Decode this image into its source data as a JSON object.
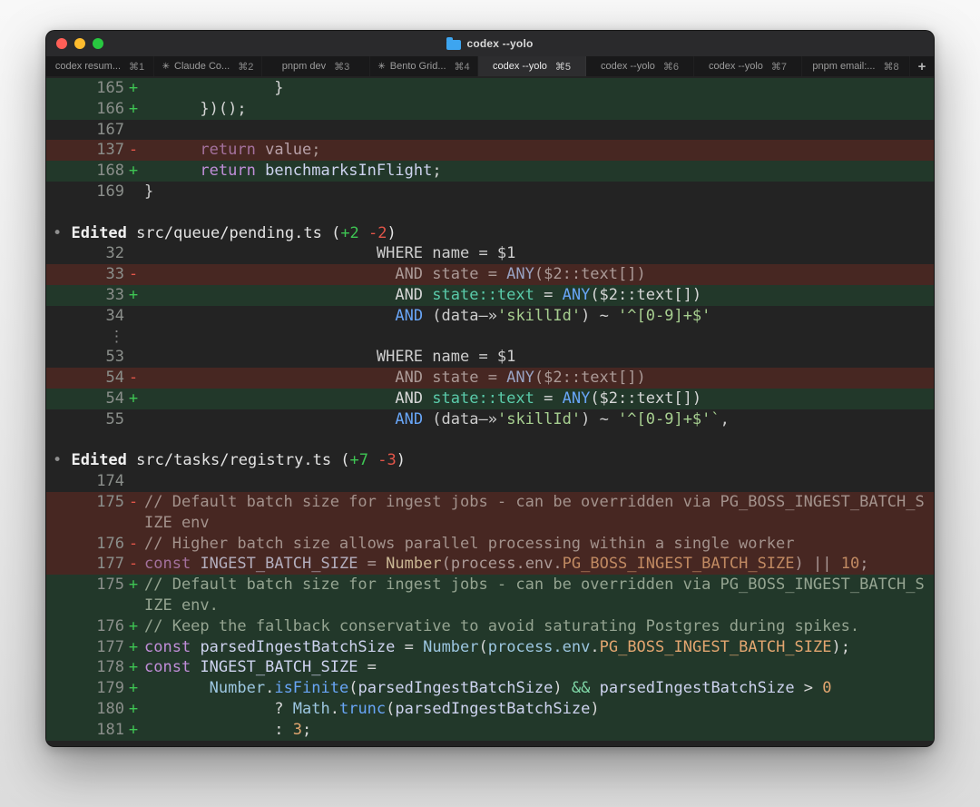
{
  "window": {
    "title": "codex --yolo"
  },
  "tabs": [
    {
      "label": "codex resum...",
      "shortcut": "⌘1",
      "active": false,
      "busy": false
    },
    {
      "label": "Claude Co...",
      "shortcut": "⌘2",
      "active": false,
      "busy": true
    },
    {
      "label": "pnpm dev",
      "shortcut": "⌘3",
      "active": false,
      "busy": false
    },
    {
      "label": "Bento Grid...",
      "shortcut": "⌘4",
      "active": false,
      "busy": true
    },
    {
      "label": "codex --yolo",
      "shortcut": "⌘5",
      "active": true,
      "busy": false
    },
    {
      "label": "codex --yolo",
      "shortcut": "⌘6",
      "active": false,
      "busy": false
    },
    {
      "label": "codex --yolo",
      "shortcut": "⌘7",
      "active": false,
      "busy": false
    },
    {
      "label": "pnpm email:...",
      "shortcut": "⌘8",
      "active": false,
      "busy": false
    }
  ],
  "new_tab_label": "+",
  "busy_icon": "✳",
  "colors": {
    "terminal_bg": "#232323",
    "add_bg": "#22382a",
    "del_bg": "#472722",
    "traffic_red": "#ff5f57",
    "traffic_yellow": "#febc2e",
    "traffic_green": "#28c840",
    "folder_icon": "#3da5f0",
    "palette": {
      "fg": "#d6d6d6",
      "ctx": "#cdcdcd",
      "kw": "#c08dd8",
      "kwdim": "#a3719d",
      "vr": "#ced3ef",
      "vrdim": "#b7a0a8",
      "vrdel": "#b3aebd",
      "blue": "#68a5f6",
      "bluedim": "#98a2c2",
      "teal": "#5acbaa",
      "op": "#80d8a8",
      "proc": "#9cc6e0",
      "str": "#a7cf90",
      "orange": "#e3a670",
      "orangedim": "#c18a62",
      "cream": "#c9b693",
      "com": "#95a491",
      "comdel": "#a3928c",
      "deltext": "#ab9a97",
      "bullet": "#8f8f8f",
      "hdrb": "#f0f0f0",
      "hdr": "#e3e3e3",
      "plus": "#3ec553",
      "minus": "#e25549",
      "dim": "#8a8a8a"
    }
  },
  "edits": [
    {
      "file": "src/queue/pending.ts",
      "added": 2,
      "removed": 2
    },
    {
      "file": "src/tasks/registry.ts",
      "added": 7,
      "removed": 3
    }
  ],
  "terminal": {
    "rows": [
      {
        "kind": "add",
        "num": "165",
        "sign": "+",
        "segs": [
          [
            "              }",
            "fg"
          ]
        ]
      },
      {
        "kind": "add",
        "num": "166",
        "sign": "+",
        "segs": [
          [
            "      })();",
            "fg"
          ]
        ]
      },
      {
        "kind": "ctx",
        "num": "167",
        "sign": "",
        "segs": []
      },
      {
        "kind": "del",
        "num": "137",
        "sign": "-",
        "segs": [
          [
            "      ",
            "deltext"
          ],
          [
            "return",
            "kwdim"
          ],
          [
            " ",
            "deltext"
          ],
          [
            "value",
            "vrdim"
          ],
          [
            ";",
            "deltext"
          ]
        ]
      },
      {
        "kind": "add",
        "num": "168",
        "sign": "+",
        "segs": [
          [
            "      ",
            "fg"
          ],
          [
            "return",
            "kw"
          ],
          [
            " ",
            "fg"
          ],
          [
            "benchmarksInFlight",
            "vr"
          ],
          [
            ";",
            "fg"
          ]
        ]
      },
      {
        "kind": "ctx",
        "num": "169",
        "sign": "",
        "segs": [
          [
            "}",
            "ctx"
          ]
        ]
      },
      {
        "kind": "blank"
      },
      {
        "kind": "header",
        "segs": [
          [
            "• ",
            "bullet"
          ],
          [
            "Edited",
            "hdrb"
          ],
          [
            " src/queue/pending.ts (",
            "hdr"
          ],
          [
            "+2",
            "plus"
          ],
          [
            " ",
            "hdr"
          ],
          [
            "-2",
            "minus"
          ],
          [
            ")",
            "hdr"
          ]
        ]
      },
      {
        "kind": "ctx",
        "num": "32",
        "sign": "",
        "segs": [
          [
            "                         WHERE name = $1",
            "ctx"
          ]
        ]
      },
      {
        "kind": "del",
        "num": "33",
        "sign": "-",
        "segs": [
          [
            "                           AND state = ",
            "deltext"
          ],
          [
            "ANY",
            "bluedim"
          ],
          [
            "($2::text[])",
            "deltext"
          ]
        ]
      },
      {
        "kind": "add",
        "num": "33",
        "sign": "+",
        "segs": [
          [
            "                           AND ",
            "fg"
          ],
          [
            "state::text",
            "teal"
          ],
          [
            " = ",
            "fg"
          ],
          [
            "ANY",
            "blue"
          ],
          [
            "($2::text[])",
            "fg"
          ]
        ]
      },
      {
        "kind": "ctx",
        "num": "34",
        "sign": "",
        "segs": [
          [
            "                           ",
            "ctx"
          ],
          [
            "AND",
            "blue"
          ],
          [
            " (data",
            "ctx"
          ],
          [
            "—»",
            "ctx"
          ],
          [
            "'skillId'",
            "str"
          ],
          [
            ") ~ ",
            "ctx"
          ],
          [
            "'^[0-9]+$'",
            "str"
          ]
        ]
      },
      {
        "kind": "ellipsis",
        "glyph": "⋮"
      },
      {
        "kind": "ctx",
        "num": "53",
        "sign": "",
        "segs": [
          [
            "                         WHERE name = $1",
            "ctx"
          ]
        ]
      },
      {
        "kind": "del",
        "num": "54",
        "sign": "-",
        "segs": [
          [
            "                           AND state = ",
            "deltext"
          ],
          [
            "ANY",
            "bluedim"
          ],
          [
            "($2::text[])",
            "deltext"
          ]
        ]
      },
      {
        "kind": "add",
        "num": "54",
        "sign": "+",
        "segs": [
          [
            "                           AND ",
            "fg"
          ],
          [
            "state::text",
            "teal"
          ],
          [
            " = ",
            "fg"
          ],
          [
            "ANY",
            "blue"
          ],
          [
            "($2::text[])",
            "fg"
          ]
        ]
      },
      {
        "kind": "ctx",
        "num": "55",
        "sign": "",
        "segs": [
          [
            "                           ",
            "ctx"
          ],
          [
            "AND",
            "blue"
          ],
          [
            " (data",
            "ctx"
          ],
          [
            "—»",
            "ctx"
          ],
          [
            "'skillId'",
            "str"
          ],
          [
            ") ~ ",
            "ctx"
          ],
          [
            "'^[0-9]+$'",
            "str"
          ],
          [
            "`",
            "str"
          ],
          [
            ",",
            "ctx"
          ]
        ]
      },
      {
        "kind": "blank"
      },
      {
        "kind": "header",
        "segs": [
          [
            "• ",
            "bullet"
          ],
          [
            "Edited",
            "hdrb"
          ],
          [
            " src/tasks/registry.ts (",
            "hdr"
          ],
          [
            "+7",
            "plus"
          ],
          [
            " ",
            "hdr"
          ],
          [
            "-3",
            "minus"
          ],
          [
            ")",
            "hdr"
          ]
        ]
      },
      {
        "kind": "ctx",
        "num": "174",
        "sign": "",
        "segs": []
      },
      {
        "kind": "del",
        "num": "175",
        "sign": "-",
        "segs": [
          [
            "// Default batch size for ingest jobs - can be overridden via PG_BOSS_INGEST_BATCH_S\nIZE env",
            "comdel"
          ]
        ]
      },
      {
        "kind": "del",
        "num": "176",
        "sign": "-",
        "segs": [
          [
            "// Higher batch size allows parallel processing within a single worker",
            "comdel"
          ]
        ]
      },
      {
        "kind": "del",
        "num": "177",
        "sign": "-",
        "segs": [
          [
            "const",
            "kwdim"
          ],
          [
            " ",
            "deltext"
          ],
          [
            "INGEST_BATCH_SIZE",
            "vrdel"
          ],
          [
            " = ",
            "deltext"
          ],
          [
            "Number",
            "cream"
          ],
          [
            "(process.env.",
            "deltext"
          ],
          [
            "PG_BOSS_INGEST_BATCH_SIZE",
            "orangedim"
          ],
          [
            ") || ",
            "deltext"
          ],
          [
            "10",
            "orangedim"
          ],
          [
            ";",
            "deltext"
          ]
        ]
      },
      {
        "kind": "add",
        "num": "175",
        "sign": "+",
        "segs": [
          [
            "// Default batch size for ingest jobs - can be overridden via PG_BOSS_INGEST_BATCH_S\nIZE env.",
            "com"
          ]
        ]
      },
      {
        "kind": "add",
        "num": "176",
        "sign": "+",
        "segs": [
          [
            "// Keep the fallback conservative to avoid saturating Postgres during spikes.",
            "com"
          ]
        ]
      },
      {
        "kind": "add",
        "num": "177",
        "sign": "+",
        "segs": [
          [
            "const",
            "kw"
          ],
          [
            " ",
            "fg"
          ],
          [
            "parsedIngestBatchSize",
            "vr"
          ],
          [
            " = ",
            "fg"
          ],
          [
            "Number",
            "proc"
          ],
          [
            "(",
            "fg"
          ],
          [
            "process.env",
            "proc"
          ],
          [
            ".",
            "fg"
          ],
          [
            "PG_BOSS_INGEST_BATCH_SIZE",
            "orange"
          ],
          [
            ");",
            "fg"
          ]
        ]
      },
      {
        "kind": "add",
        "num": "178",
        "sign": "+",
        "segs": [
          [
            "const",
            "kw"
          ],
          [
            " ",
            "fg"
          ],
          [
            "INGEST_BATCH_SIZE",
            "vr"
          ],
          [
            " =",
            "fg"
          ]
        ]
      },
      {
        "kind": "add",
        "num": "179",
        "sign": "+",
        "segs": [
          [
            "       ",
            "fg"
          ],
          [
            "Number",
            "proc"
          ],
          [
            ".",
            "fg"
          ],
          [
            "isFinite",
            "blue"
          ],
          [
            "(",
            "fg"
          ],
          [
            "parsedIngestBatchSize",
            "vr"
          ],
          [
            ") ",
            "fg"
          ],
          [
            "&&",
            "op"
          ],
          [
            " ",
            "fg"
          ],
          [
            "parsedIngestBatchSize",
            "vr"
          ],
          [
            " > ",
            "fg"
          ],
          [
            "0",
            "orange"
          ]
        ]
      },
      {
        "kind": "add",
        "num": "180",
        "sign": "+",
        "segs": [
          [
            "              ? ",
            "fg"
          ],
          [
            "Math",
            "proc"
          ],
          [
            ".",
            "fg"
          ],
          [
            "trunc",
            "blue"
          ],
          [
            "(",
            "fg"
          ],
          [
            "parsedIngestBatchSize",
            "vr"
          ],
          [
            ")",
            "fg"
          ]
        ]
      },
      {
        "kind": "add",
        "num": "181",
        "sign": "+",
        "segs": [
          [
            "              : ",
            "fg"
          ],
          [
            "3",
            "orange"
          ],
          [
            ";",
            "fg"
          ]
        ]
      }
    ]
  }
}
